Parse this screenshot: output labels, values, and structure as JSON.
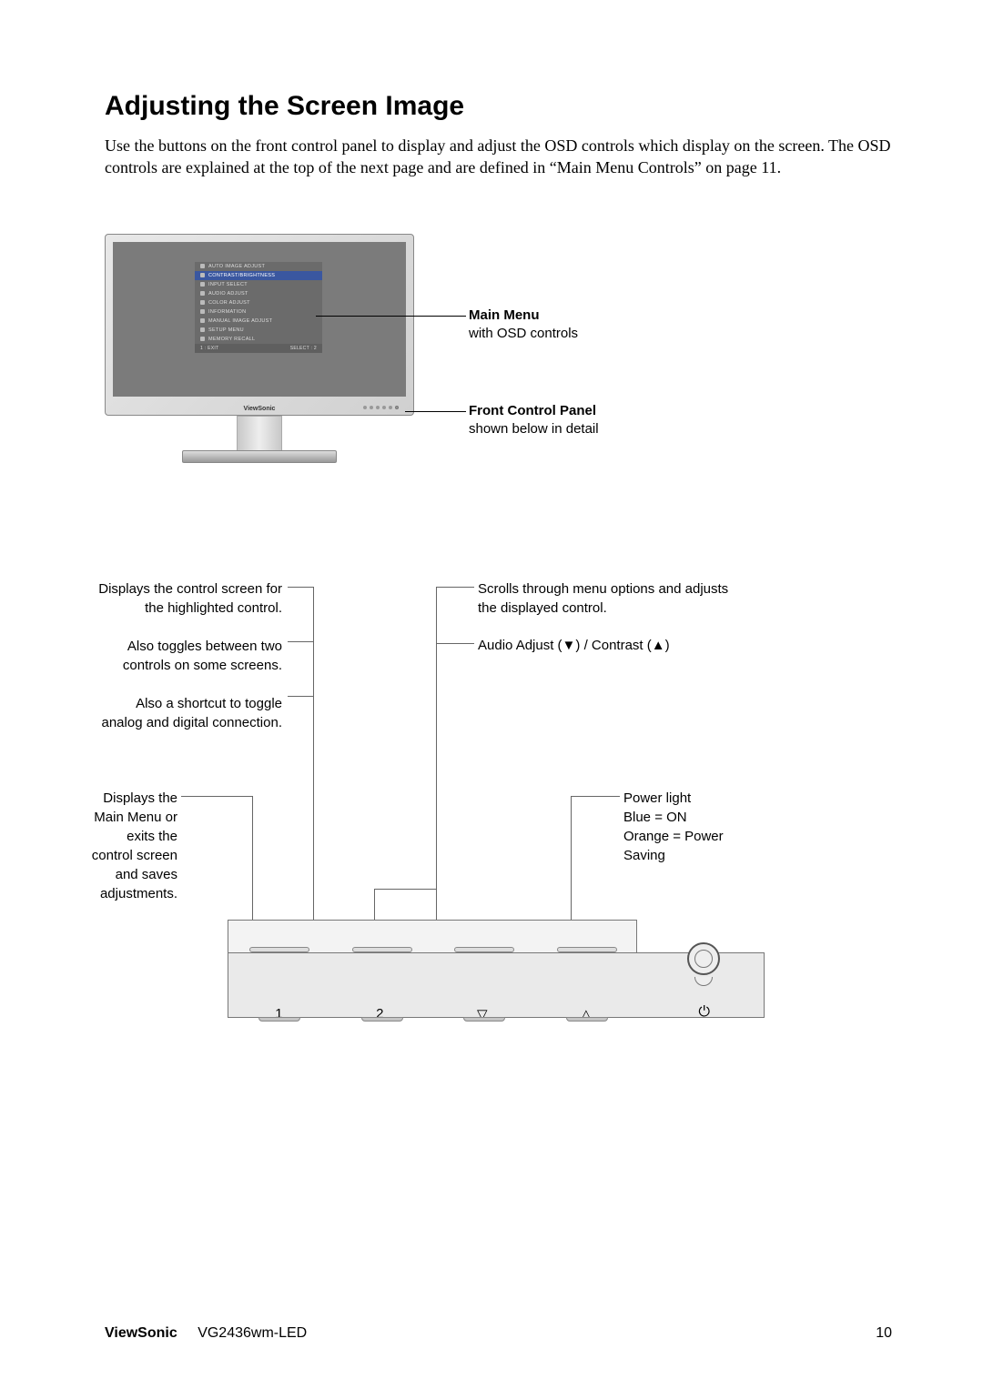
{
  "heading": "Adjusting the Screen Image",
  "intro": "Use the buttons on the front control panel to display and adjust the OSD controls which display on the screen. The OSD controls are explained at the top of the next page and are defined in “Main Menu Controls” on page 11.",
  "osd_menu": {
    "items": [
      "AUTO IMAGE ADJUST",
      "CONTRAST/BRIGHTNESS",
      "INPUT SELECT",
      "AUDIO ADJUST",
      "COLOR ADJUST",
      "INFORMATION",
      "MANUAL IMAGE ADJUST",
      "SETUP MENU",
      "MEMORY RECALL"
    ],
    "highlighted_index": 1,
    "footer_left": "1 : EXIT",
    "footer_right": "SELECT : 2"
  },
  "bezel_logo": "ViewSonic",
  "callouts": {
    "main_menu_title": "Main Menu",
    "main_menu_sub": "with OSD controls",
    "fcp_title": "Front Control Panel",
    "fcp_sub": "shown below in detail"
  },
  "labels": {
    "l1a": "Displays the control screen for the highlighted control.",
    "l1b": "Also toggles between two controls on some screens.",
    "l1c": "Also a shortcut to toggle analog and digital connection.",
    "l2": "Displays the Main Menu or exits the control screen and saves adjustments.",
    "r1": "Scrolls through menu options and adjusts the displayed control.",
    "r2": "Audio Adjust (▼) / Contrast  (▲)",
    "r3a": "Power light",
    "r3b": "Blue = ON",
    "r3c": "Orange = Power Saving"
  },
  "buttons": {
    "b1": "1",
    "b2": "2",
    "down": "▽",
    "up": "△",
    "power": "⏻"
  },
  "footer": {
    "brand": "ViewSonic",
    "model": "VG2436wm-LED",
    "page": "10"
  }
}
